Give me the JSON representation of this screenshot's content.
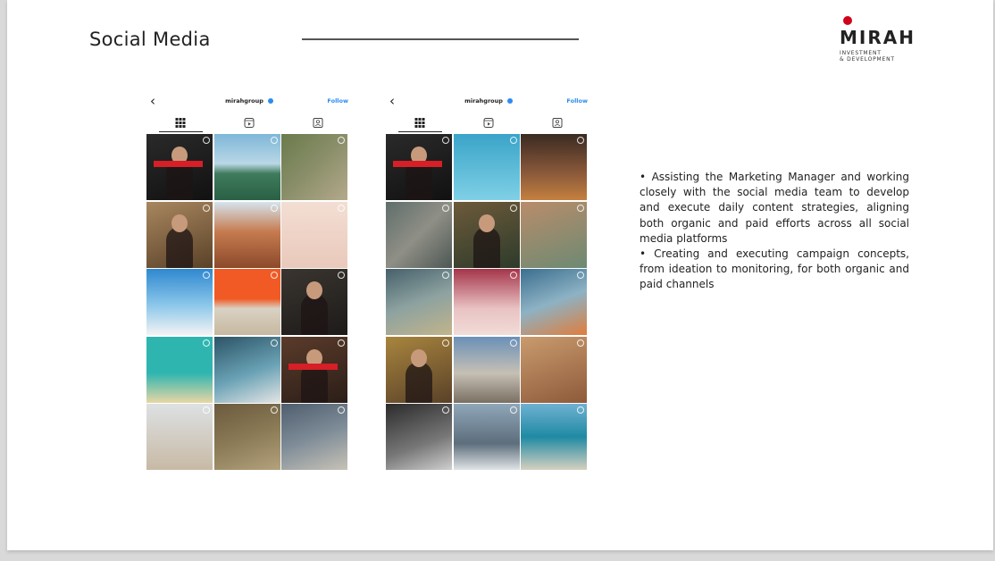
{
  "slide": {
    "title": "Social Media"
  },
  "logo": {
    "name": "MIRAH",
    "tagline_line1": "INVESTMENT",
    "tagline_line2": "& DEVELOPMENT",
    "dot_color": "#d0021b"
  },
  "phones": [
    {
      "back_icon": "chevron-left-icon",
      "profile_name": "mirahgroup",
      "follow_label": "Follow",
      "tabs": [
        "grid-icon",
        "reels-icon",
        "tagged-icon"
      ],
      "tiles": [
        {
          "bg": "linear-gradient(160deg,#2a2a2a,#111)",
          "type": "person",
          "badge": true
        },
        {
          "bg": "linear-gradient(180deg,#7fb7d8 0%,#b9d7e6 45%,#3f7b5c 60%,#2a6046 100%)",
          "type": "plain"
        },
        {
          "bg": "linear-gradient(135deg,#6b7a4b,#8a8f6a 50%,#b4a98b)",
          "type": "plain"
        },
        {
          "bg": "linear-gradient(160deg,#a8875f,#5a4128)",
          "type": "person",
          "badge": false
        },
        {
          "bg": "linear-gradient(180deg,#d5e4ee 0%,#c67b4f 45%,#8b4a2b 100%)",
          "type": "plain"
        },
        {
          "bg": "linear-gradient(180deg,#f3ded3,#e9c9bb)",
          "type": "plain"
        },
        {
          "bg": "linear-gradient(180deg,#2f88cf 0%,#8cc7ea 55%,#f3f3f3 100%)",
          "type": "plain"
        },
        {
          "bg": "linear-gradient(180deg,#f15a24 0%,#f15a24 45%,#d9d2c3 60%,#c7b8a0 100%)",
          "type": "plain"
        },
        {
          "bg": "linear-gradient(160deg,#3a3530,#1d1a18)",
          "type": "person",
          "badge": false
        },
        {
          "bg": "linear-gradient(180deg,#2fb5b0 0%,#2fb5b0 55%,#e8d6a4 100%)",
          "type": "plain"
        },
        {
          "bg": "linear-gradient(160deg,#2c5366,#6aa2b5 55%,#e5e5e5)",
          "type": "plain"
        },
        {
          "bg": "linear-gradient(160deg,#5b3b2a,#2b1e18)",
          "type": "person",
          "badge": true
        },
        {
          "bg": "linear-gradient(180deg,#dde1e3,#c8b9a5)",
          "type": "plain"
        },
        {
          "bg": "linear-gradient(160deg,#6b5a3e,#8a7a55 50%,#b3a27c)",
          "type": "plain"
        },
        {
          "bg": "linear-gradient(160deg,#4f5e6e,#7e8c98 50%,#c7c2b6)",
          "type": "plain"
        }
      ]
    },
    {
      "back_icon": "chevron-left-icon",
      "profile_name": "mirahgroup",
      "follow_label": "Follow",
      "tabs": [
        "grid-icon",
        "reels-icon",
        "tagged-icon"
      ],
      "tiles": [
        {
          "bg": "linear-gradient(160deg,#2a2a2a,#111)",
          "type": "person",
          "badge": true
        },
        {
          "bg": "linear-gradient(180deg,#3aa4c8,#7fd0e6)",
          "type": "plain"
        },
        {
          "bg": "linear-gradient(180deg,#3a2a22,#8c5a3a 60%,#c4803f)",
          "type": "plain"
        },
        {
          "bg": "linear-gradient(135deg,#5f6e6b,#8f8f86 50%,#4d5753)",
          "type": "plain"
        },
        {
          "bg": "linear-gradient(160deg,#6d5a3a,#2d3b2b)",
          "type": "person",
          "badge": false
        },
        {
          "bg": "linear-gradient(160deg,#b98c6a,#6d8a73)",
          "type": "plain"
        },
        {
          "bg": "linear-gradient(160deg,#46606b,#8da2a0 50%,#c2b48b)",
          "type": "plain"
        },
        {
          "bg": "linear-gradient(180deg,#a4354a,#e9c2c3 60%,#f1dcd8)",
          "type": "plain"
        },
        {
          "bg": "linear-gradient(160deg,#3b6e8f,#8db2c4 50%,#e07d3c)",
          "type": "plain"
        },
        {
          "bg": "linear-gradient(160deg,#a8853e,#5a4128)",
          "type": "person",
          "badge": false
        },
        {
          "bg": "linear-gradient(180deg,#6a90b8 0%,#c6c0b4 55%,#7a6f63 100%)",
          "type": "plain"
        },
        {
          "bg": "linear-gradient(160deg,#c99b6e,#8e5a3a)",
          "type": "plain"
        },
        {
          "bg": "linear-gradient(160deg,#2b2b2b,#777 60%,#cfcfcf)",
          "type": "plain"
        },
        {
          "bg": "linear-gradient(180deg,#8fa7b9,#5d6e7c 60%,#e0e4e6)",
          "type": "plain"
        },
        {
          "bg": "linear-gradient(180deg,#6fb1d2 0%,#1f8aa3 50%,#d6d0c0 100%)",
          "type": "plain"
        }
      ]
    }
  ],
  "bullets": [
    "• Assisting the Marketing Manager and working closely with the social media team to develop and execute daily content strategies, aligning both organic and paid efforts across all social media platforms",
    "• Creating and executing campaign concepts, from ideation to monitoring, for both organic and paid channels"
  ]
}
